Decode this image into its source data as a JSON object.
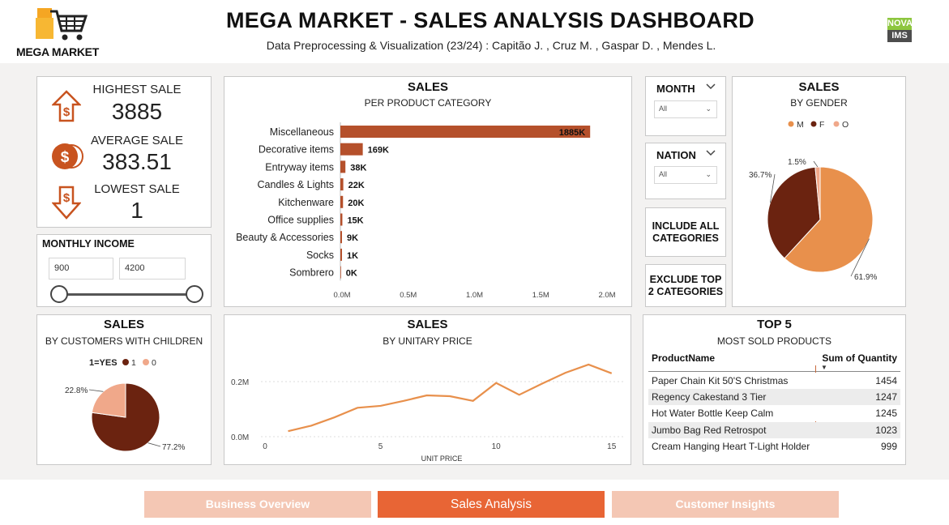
{
  "header": {
    "logo_text": "MEGA MARKET",
    "title": "MEGA MARKET - SALES ANALYSIS DASHBOARD",
    "subtitle": "Data Preprocessing & Visualization (23/24) : Capitão J. ,  Cruz M. ,  Gaspar D. ,  Mendes L.",
    "nova_line1": "NOVA",
    "nova_line2": "IMS"
  },
  "kpis": {
    "highest_label": "HIGHEST SALE",
    "highest_value": "3885",
    "average_label": "AVERAGE SALE",
    "average_value": "383.51",
    "lowest_label": "LOWEST SALE",
    "lowest_value": "1"
  },
  "monthly_income": {
    "title": "MONTHLY INCOME",
    "min_value": "900",
    "max_value": "4200"
  },
  "slicers": {
    "month_title": "MONTH",
    "month_value": "All",
    "nation_title": "NATION",
    "nation_value": "All"
  },
  "buttons": {
    "include_all": "INCLUDE ALL CATEGORIES",
    "exclude_top": "EXCLUDE TOP 2 CATEGORIES"
  },
  "colors": {
    "bar": "#b5502b",
    "dark_brown": "#6b2310",
    "orange": "#e8904c",
    "peach": "#f0a88a",
    "tab_active": "#e86535",
    "tab_inactive": "#f4c7b4"
  },
  "chart_data": [
    {
      "type": "bar",
      "title": "SALES",
      "subtitle": "PER PRODUCT CATEGORY",
      "orientation": "horizontal",
      "categories": [
        "Miscellaneous",
        "Decorative items",
        "Entryway items",
        "Candles & Lights",
        "Kitchenware",
        "Office supplies",
        "Beauty & Accessories",
        "Socks",
        "Sombrero"
      ],
      "values": [
        1885000,
        169000,
        38000,
        22000,
        20000,
        15000,
        9000,
        1000,
        0
      ],
      "data_labels": [
        "1885K",
        "169K",
        "38K",
        "22K",
        "20K",
        "15K",
        "9K",
        "1K",
        "0K"
      ],
      "xlim": [
        0,
        2000000
      ],
      "x_ticks": [
        "0.0M",
        "0.5M",
        "1.0M",
        "1.5M",
        "2.0M"
      ]
    },
    {
      "type": "pie",
      "title": "SALES",
      "subtitle": "BY GENDER",
      "legend": [
        "M",
        "F",
        "O"
      ],
      "values": [
        61.9,
        36.7,
        1.5
      ],
      "labels": [
        "61.9%",
        "36.7%",
        "1.5%"
      ]
    },
    {
      "type": "pie",
      "title": "SALES",
      "subtitle": "BY CUSTOMERS WITH CHILDREN",
      "legend_title": "1=YES",
      "legend": [
        "1",
        "0"
      ],
      "values": [
        77.2,
        22.8
      ],
      "labels": [
        "77.2%",
        "22.8%"
      ]
    },
    {
      "type": "line",
      "title": "SALES",
      "subtitle": "BY UNITARY PRICE",
      "xlabel": "UNIT PRICE",
      "x": [
        1,
        2,
        3,
        4,
        5,
        6,
        7,
        8,
        9,
        10,
        11,
        12,
        13,
        14,
        15
      ],
      "y": [
        20000,
        40000,
        70000,
        105000,
        112000,
        130000,
        150000,
        147000,
        130000,
        195000,
        152000,
        193000,
        232000,
        262000,
        230000
      ],
      "x_ticks": [
        "0",
        "5",
        "10",
        "15"
      ],
      "y_ticks": [
        "0.0M",
        "0.2M"
      ],
      "xlim": [
        0,
        15.5
      ],
      "ylim": [
        0,
        300000
      ]
    }
  ],
  "top5": {
    "title": "TOP 5",
    "subtitle": "MOST SOLD PRODUCTS",
    "col_product": "ProductName",
    "col_qty": "Sum of Quantity",
    "rows": [
      {
        "name": "Paper Chain Kit 50'S Christmas",
        "qty": "1454"
      },
      {
        "name": "Regency Cakestand 3 Tier",
        "qty": "1247"
      },
      {
        "name": "Hot Water Bottle Keep Calm",
        "qty": "1245"
      },
      {
        "name": "Jumbo Bag Red Retrospot",
        "qty": "1023"
      },
      {
        "name": "Cream Hanging Heart T-Light Holder",
        "qty": "999"
      }
    ]
  },
  "tabs": [
    {
      "label": "Business Overview",
      "active": false
    },
    {
      "label": "Sales Analysis",
      "active": true
    },
    {
      "label": "Customer Insights",
      "active": false
    }
  ]
}
